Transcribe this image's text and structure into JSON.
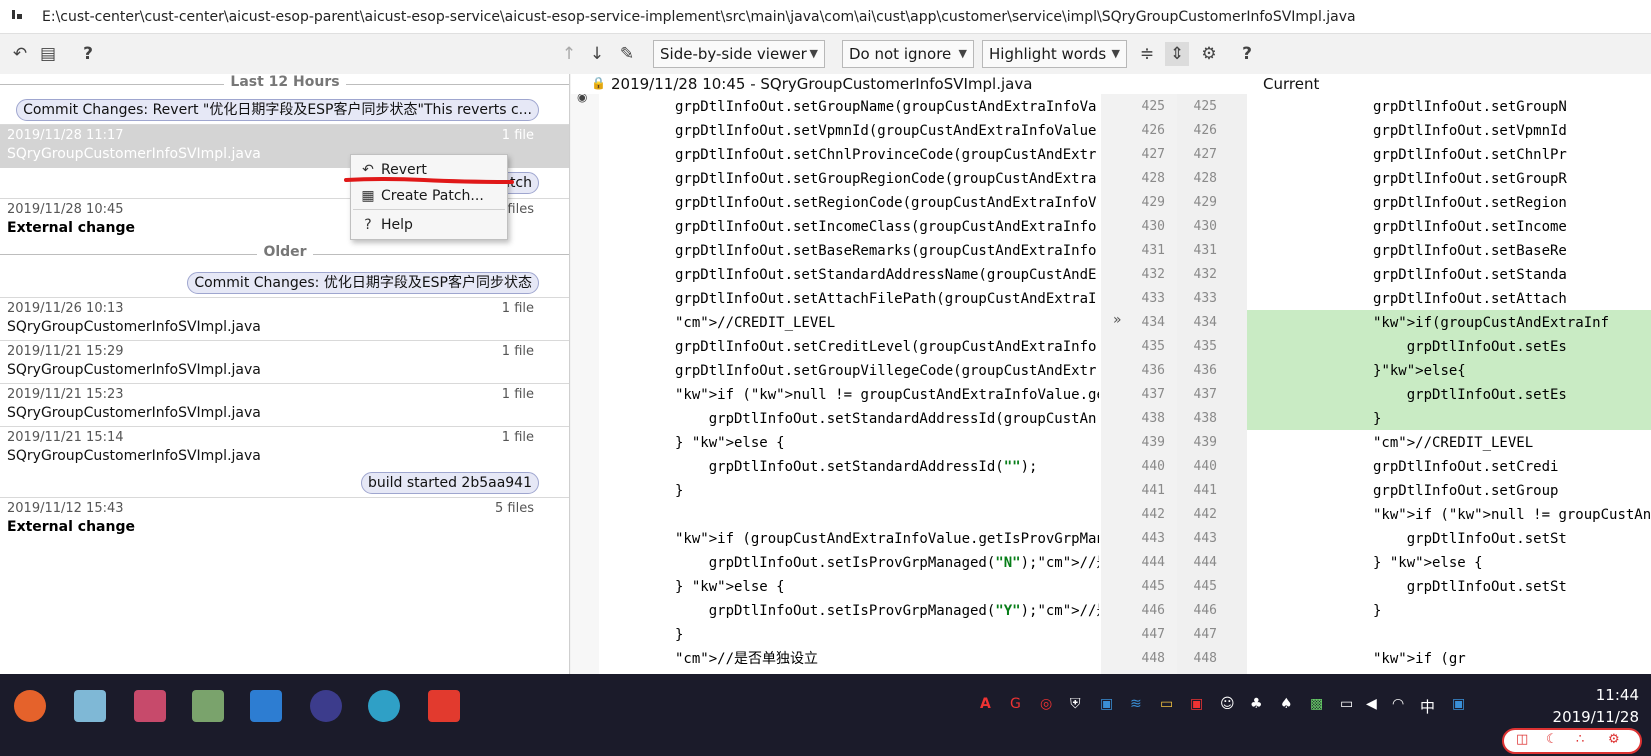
{
  "window": {
    "title": "E:\\cust-center\\cust-center\\aicust-esop-parent\\aicust-esop-service\\aicust-esop-service-implement\\src\\main\\java\\com\\ai\\cust\\app\\customer\\service\\impl\\SQryGroupCustomerInfoSVImpl.java"
  },
  "left_toolbar": {
    "revert_icon": "undo-icon",
    "clipboard_icon": "clipboard-icon",
    "help_label": "?"
  },
  "history": {
    "group_recent": "Last 12 Hours",
    "group_older": "Older",
    "badges": [
      "Commit Changes: Revert \"优化日期字段及ESP客户同步状态\"This reverts c...",
      "r patch",
      "Commit Changes: 优化日期字段及ESP客户同步状态",
      "build started 2b5aa941"
    ],
    "revisions": [
      {
        "date": "2019/11/28 11:17",
        "name": "SQryGroupCustomerInfoSVImpl.java",
        "count": "1 file",
        "external": false
      },
      {
        "date": "2019/11/28 10:45",
        "name": "External change",
        "count": "4 files",
        "external": true
      },
      {
        "date": "2019/11/26 10:13",
        "name": "SQryGroupCustomerInfoSVImpl.java",
        "count": "1 file",
        "external": false
      },
      {
        "date": "2019/11/21 15:29",
        "name": "SQryGroupCustomerInfoSVImpl.java",
        "count": "1 file",
        "external": false
      },
      {
        "date": "2019/11/21 15:23",
        "name": "SQryGroupCustomerInfoSVImpl.java",
        "count": "1 file",
        "external": false
      },
      {
        "date": "2019/11/21 15:14",
        "name": "SQryGroupCustomerInfoSVImpl.java",
        "count": "1 file",
        "external": false
      },
      {
        "date": "2019/11/12 15:43",
        "name": "External change",
        "count": "5 files",
        "external": true
      }
    ]
  },
  "context_menu": {
    "items": [
      "Revert",
      "Create Patch...",
      "Help"
    ]
  },
  "diff_toolbar": {
    "viewer": "Side-by-side viewer",
    "ignore": "Do not ignore",
    "highlight": "Highlight words",
    "help_label": "?"
  },
  "diff_header": {
    "left_title": "2019/11/28 10:45 - SQryGroupCustomerInfoSVImpl.java",
    "right_title": "Current"
  },
  "left_code": [
    "grpDtlInfoOut.setGroupName(groupCustAndExtraInfoVa",
    "grpDtlInfoOut.setVpmnId(groupCustAndExtraInfoValue",
    "grpDtlInfoOut.setChnlProvinceCode(groupCustAndExtr",
    "grpDtlInfoOut.setGroupRegionCode(groupCustAndExtra",
    "grpDtlInfoOut.setRegionCode(groupCustAndExtraInfoV",
    "grpDtlInfoOut.setIncomeClass(groupCustAndExtraInfo",
    "grpDtlInfoOut.setBaseRemarks(groupCustAndExtraInfo",
    "grpDtlInfoOut.setStandardAddressName(groupCustAndE",
    "grpDtlInfoOut.setAttachFilePath(groupCustAndExtraI",
    "//CREDIT_LEVEL",
    "grpDtlInfoOut.setCreditLevel(groupCustAndExtraInfo",
    "grpDtlInfoOut.setGroupVillegeCode(groupCustAndExtr",
    "if (null != groupCustAndExtraInfoValue.getStandarc",
    "    grpDtlInfoOut.setStandardAddressId(groupCustAn",
    "} else {",
    "    grpDtlInfoOut.setStandardAddressId(\"\");",
    "}",
    "",
    "if (groupCustAndExtraInfoValue.getIsProvGrpManagec",
    "    grpDtlInfoOut.setIsProvGrpManaged(\"N\");//是否省",
    "} else {",
    "    grpDtlInfoOut.setIsProvGrpManaged(\"Y\");//是否省",
    "}",
    "//是否单独设立"
  ],
  "left_numbers": [
    "425",
    "426",
    "427",
    "428",
    "429",
    "430",
    "431",
    "432",
    "433",
    "434",
    "435",
    "436",
    "437",
    "438",
    "439",
    "440",
    "441",
    "442",
    "443",
    "444",
    "445",
    "446",
    "447",
    "448"
  ],
  "right_numbers": [
    "425",
    "426",
    "427",
    "428",
    "429",
    "430",
    "431",
    "432",
    "433",
    "434",
    "435",
    "436",
    "437",
    "438",
    "439",
    "440",
    "441",
    "442",
    "443",
    "444",
    "445",
    "446",
    "447",
    "448"
  ],
  "right_code": [
    "grpDtlInfoOut.setGroupN",
    "grpDtlInfoOut.setVpmnId",
    "grpDtlInfoOut.setChnlPr",
    "grpDtlInfoOut.setGroupR",
    "grpDtlInfoOut.setRegion",
    "grpDtlInfoOut.setIncome",
    "grpDtlInfoOut.setBaseRe",
    "grpDtlInfoOut.setStanda",
    "grpDtlInfoOut.setAttach",
    "if(groupCustAndExtraInf",
    "    grpDtlInfoOut.setEs",
    "}else{",
    "    grpDtlInfoOut.setEs",
    "}",
    "//CREDIT_LEVEL",
    "grpDtlInfoOut.setCredi",
    "grpDtlInfoOut.setGroup",
    "if (null != groupCustAn",
    "    grpDtlInfoOut.setSt",
    "} else {",
    "    grpDtlInfoOut.setSt",
    "}",
    "",
    "if (gr"
  ],
  "taskbar": {
    "ime_label": "中",
    "time": "11:44",
    "date": "2019/11/28"
  }
}
